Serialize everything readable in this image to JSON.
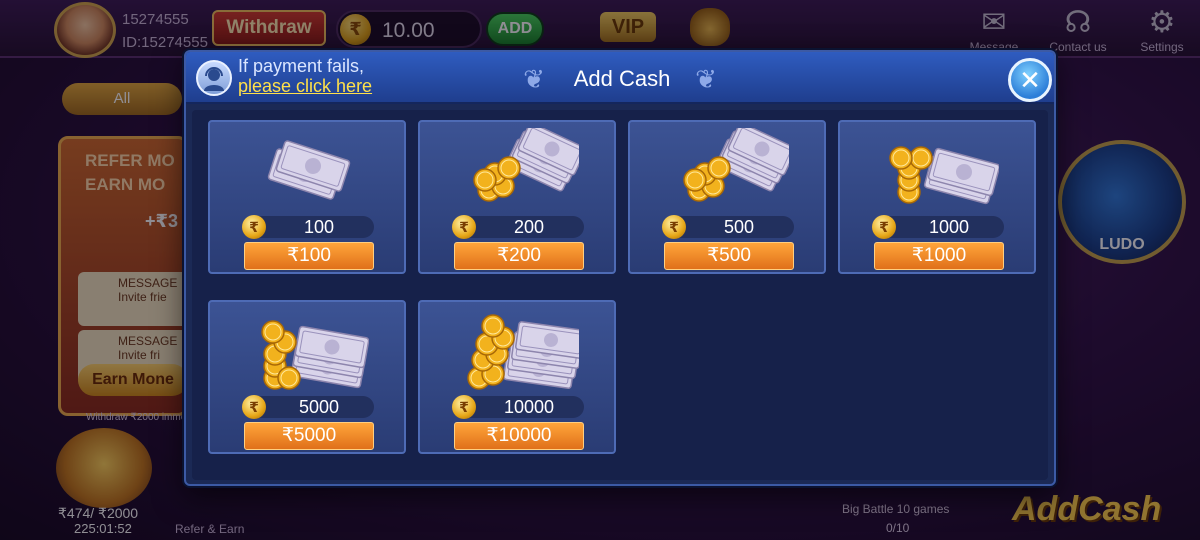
{
  "topbar": {
    "account_number": "15274555",
    "account_id": "ID:15274555",
    "withdraw_label": "Withdraw",
    "balance_symbol": "₹",
    "balance": "10.00",
    "add_label": "ADD",
    "vip_label": "VIP",
    "message_label": "Message",
    "contact_label": "Contact us",
    "settings_label": "Settings"
  },
  "lobby": {
    "all_tab_label": "All",
    "refer_line1": "REFER MO",
    "refer_line2": "EARN MO",
    "bonus_text": "+₹3",
    "message_title_1": "MESSAGE",
    "message_text_1": "Invite frie",
    "message_title_2": "MESSAGE",
    "message_text_2": "Invite fri",
    "earn_button": "Earn Mone",
    "withdraw_note": "Withdraw ₹2000 immedia",
    "progress_text": "₹474/ ₹2000",
    "timer": "225:01:52",
    "refer_earn_label": "Refer & Earn",
    "ludo_label": "LUDO",
    "big_battle_text": "Big Battle 10 games",
    "big_battle_progress": "0/10",
    "add_cash_banner": "AddCash"
  },
  "modal": {
    "fail_text": "If payment fails,",
    "fail_link": "please click here",
    "title": "Add Cash",
    "close_label": "✕",
    "currency_symbol": "₹",
    "packs": [
      {
        "amount": "100",
        "price": "₹100",
        "art": "notes"
      },
      {
        "amount": "200",
        "price": "₹200",
        "art": "coins-notes"
      },
      {
        "amount": "500",
        "price": "₹500",
        "art": "coins-notes"
      },
      {
        "amount": "1000",
        "price": "₹1000",
        "art": "coins-stack"
      },
      {
        "amount": "5000",
        "price": "₹5000",
        "art": "coins-bundle"
      },
      {
        "amount": "10000",
        "price": "₹10000",
        "art": "coins-bundle-large"
      }
    ]
  },
  "colors": {
    "modal_bg": "#1b2955",
    "card_bg": "#3c5394",
    "price_button": "#ff9a30",
    "link": "#ffe04a"
  }
}
